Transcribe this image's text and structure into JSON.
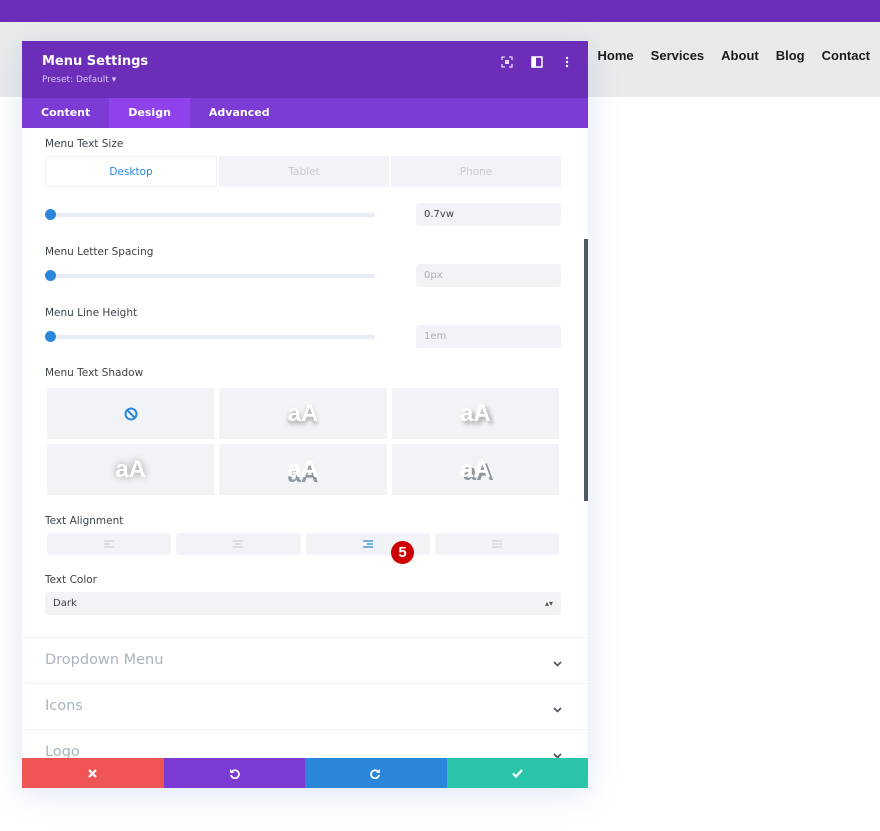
{
  "site_nav": [
    "Home",
    "Services",
    "About",
    "Blog",
    "Contact"
  ],
  "modal": {
    "title": "Menu Settings",
    "preset": "Preset: Default ▾",
    "tabs": [
      {
        "label": "Content",
        "active": false
      },
      {
        "label": "Design",
        "active": true
      },
      {
        "label": "Advanced",
        "active": false
      }
    ]
  },
  "design": {
    "text_size": {
      "label": "Menu Text Size",
      "devices": [
        "Desktop",
        "Tablet",
        "Phone"
      ],
      "active_device": "Desktop",
      "value": "0.7vw",
      "slider_fraction": 0
    },
    "letter_spacing": {
      "label": "Menu Letter Spacing",
      "value": "0px",
      "slider_fraction": 0
    },
    "line_height": {
      "label": "Menu Line Height",
      "value": "1em",
      "slider_fraction": 0
    },
    "text_shadow": {
      "label": "Menu Text Shadow",
      "preview_text": "aA",
      "options": [
        "none",
        "shadow-1",
        "shadow-2",
        "shadow-3",
        "shadow-4",
        "shadow-5"
      ],
      "selected": "none"
    },
    "text_alignment": {
      "label": "Text Alignment",
      "options": [
        "left",
        "center",
        "right",
        "justify"
      ],
      "selected": "right"
    },
    "text_color": {
      "label": "Text Color",
      "value": "Dark"
    },
    "step_badge": "5"
  },
  "sections": [
    "Dropdown Menu",
    "Icons",
    "Logo"
  ],
  "footer": {
    "buttons": [
      {
        "name": "cancel",
        "color": "#ef5555"
      },
      {
        "name": "undo",
        "color": "#7b3bd4"
      },
      {
        "name": "redo",
        "color": "#2b87da"
      },
      {
        "name": "save",
        "color": "#29c4a9"
      }
    ]
  },
  "colors": {
    "brand_purple": "#6c2eb9",
    "tab_purple": "#7b3bd4",
    "accent_blue": "#2b87da"
  }
}
